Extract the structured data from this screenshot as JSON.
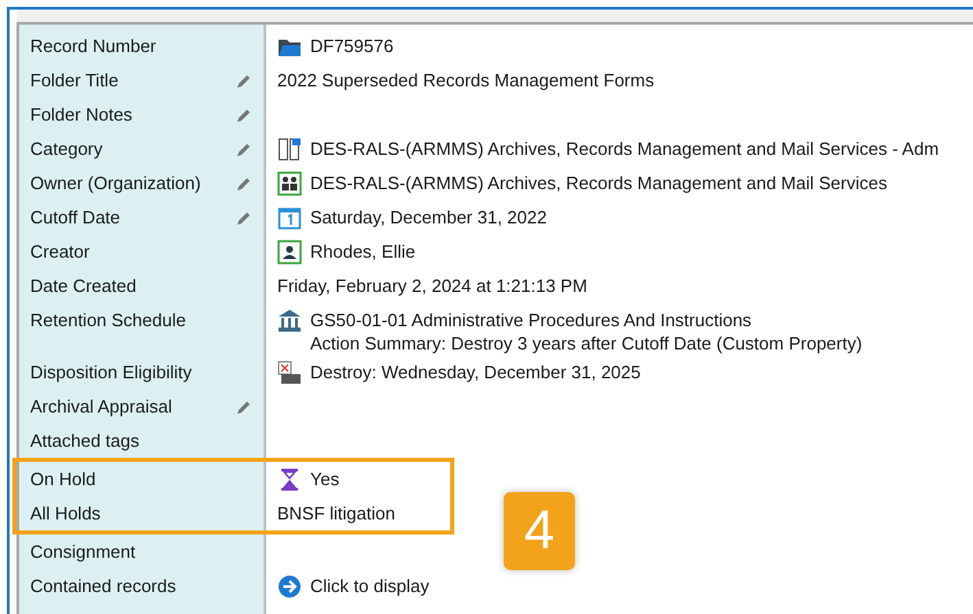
{
  "rows": [
    {
      "label": "Record Number",
      "editable": false,
      "kind": "folder",
      "lines": [
        "DF759576"
      ],
      "highlighted": false
    },
    {
      "label": "Folder Title",
      "editable": true,
      "kind": "text",
      "lines": [
        "2022 Superseded Records Management Forms"
      ],
      "highlighted": false
    },
    {
      "label": "Folder Notes",
      "editable": true,
      "kind": "text",
      "lines": [],
      "highlighted": false
    },
    {
      "label": "Category",
      "editable": true,
      "kind": "category",
      "lines": [
        "DES-RALS-(ARMMS) Archives, Records Management and Mail Services - Adm"
      ],
      "highlighted": false
    },
    {
      "label": "Owner (Organization)",
      "editable": true,
      "kind": "organization",
      "lines": [
        "DES-RALS-(ARMMS) Archives, Records Management and Mail Services"
      ],
      "highlighted": false
    },
    {
      "label": "Cutoff Date",
      "editable": true,
      "kind": "calendar",
      "lines": [
        "Saturday, December 31, 2022"
      ],
      "highlighted": false
    },
    {
      "label": "Creator",
      "editable": false,
      "kind": "person",
      "lines": [
        "Rhodes, Ellie"
      ],
      "highlighted": false
    },
    {
      "label": "Date Created",
      "editable": false,
      "kind": "text",
      "lines": [
        "Friday, February 2, 2024 at 1:21:13 PM"
      ],
      "highlighted": false
    },
    {
      "label": "Retention Schedule",
      "editable": false,
      "kind": "schedule",
      "lines": [
        "GS50-01-01 Administrative Procedures And Instructions",
        "Action Summary: Destroy 3 years after Cutoff Date (Custom Property)"
      ],
      "highlighted": false
    },
    {
      "label": "Disposition Eligibility",
      "editable": false,
      "kind": "disposition",
      "lines": [
        "Destroy: Wednesday, December 31, 2025"
      ],
      "highlighted": false
    },
    {
      "label": "Archival Appraisal",
      "editable": true,
      "kind": "text",
      "lines": [],
      "highlighted": false
    },
    {
      "label": "Attached tags",
      "editable": false,
      "kind": "text",
      "lines": [],
      "highlighted": false
    },
    {
      "label": "On Hold",
      "editable": false,
      "kind": "hold",
      "lines": [
        "Yes"
      ],
      "highlighted": true
    },
    {
      "label": "All Holds",
      "editable": false,
      "kind": "text",
      "lines": [
        "BNSF litigation"
      ],
      "highlighted": true
    },
    {
      "label": "Consignment",
      "editable": false,
      "kind": "text",
      "lines": [],
      "highlighted": false
    },
    {
      "label": "Contained records",
      "editable": false,
      "kind": "link",
      "lines": [
        "Click to display"
      ],
      "highlighted": false
    }
  ],
  "callout": {
    "number": "4"
  }
}
